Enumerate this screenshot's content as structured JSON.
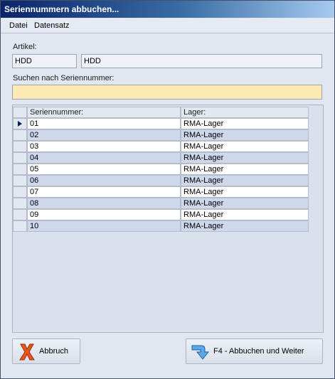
{
  "window": {
    "title": "Seriennummern abbuchen..."
  },
  "menu": {
    "items": [
      "Datei",
      "Datensatz"
    ]
  },
  "artikel": {
    "label": "Artikel:",
    "code": "HDD",
    "name": "HDD"
  },
  "search": {
    "label": "Suchen nach Seriennummer:",
    "value": ""
  },
  "grid": {
    "columns": [
      "Seriennummer:",
      "Lager:"
    ],
    "rows": [
      {
        "serial": "01",
        "lager": "RMA-Lager",
        "selected": true
      },
      {
        "serial": "02",
        "lager": "RMA-Lager"
      },
      {
        "serial": "03",
        "lager": "RMA-Lager"
      },
      {
        "serial": "04",
        "lager": "RMA-Lager"
      },
      {
        "serial": "05",
        "lager": "RMA-Lager"
      },
      {
        "serial": "06",
        "lager": "RMA-Lager"
      },
      {
        "serial": "07",
        "lager": "RMA-Lager"
      },
      {
        "serial": "08",
        "lager": "RMA-Lager"
      },
      {
        "serial": "09",
        "lager": "RMA-Lager"
      },
      {
        "serial": "10",
        "lager": "RMA-Lager"
      }
    ]
  },
  "buttons": {
    "cancel": {
      "label": "Abbruch",
      "icon": "red-x-icon"
    },
    "confirm": {
      "label": "F4 - Abbuchen und Weiter",
      "icon": "return-arrow-icon"
    }
  },
  "colors": {
    "titlebar": "#0a246a",
    "search_bg": "#fde9b4",
    "row_alt": "#cdd8ec"
  }
}
